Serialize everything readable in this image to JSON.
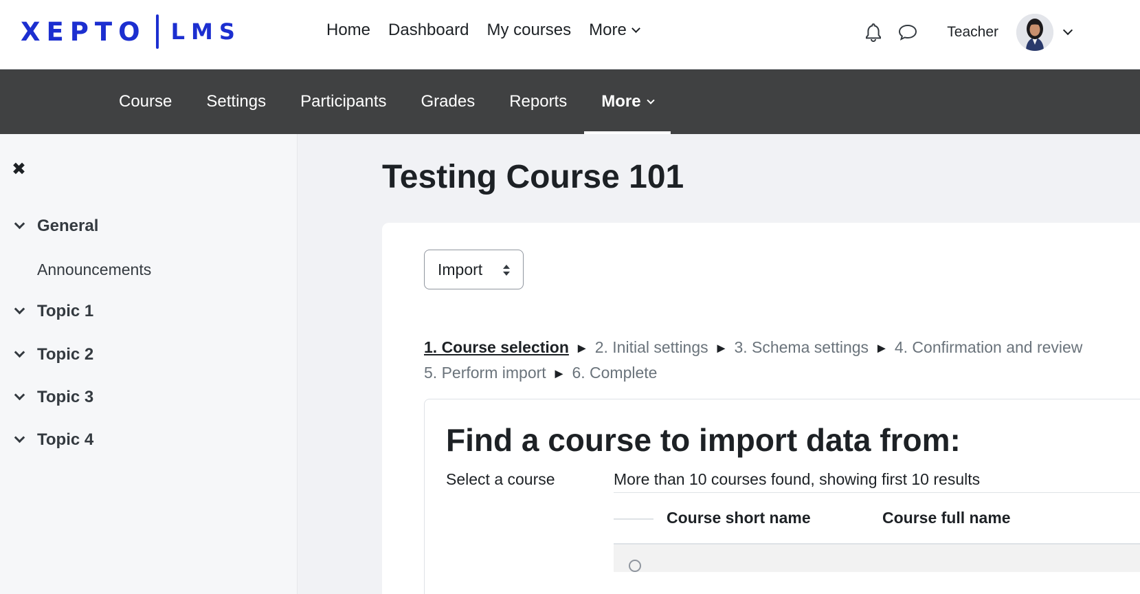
{
  "brand": {
    "logo_word": "XEPTO",
    "logo_sub": "LMS",
    "color": "#1c2fd0"
  },
  "primary_nav": {
    "home": "Home",
    "dashboard": "Dashboard",
    "my_courses": "My courses",
    "more": "More"
  },
  "user": {
    "name": "Teacher"
  },
  "secondary_nav": {
    "course": "Course",
    "settings": "Settings",
    "participants": "Participants",
    "grades": "Grades",
    "reports": "Reports",
    "more": "More"
  },
  "drawer": {
    "close": "✖",
    "sections": [
      "General",
      "Topic 1",
      "Topic 2",
      "Topic 3",
      "Topic 4"
    ],
    "general_items": [
      "Announcements"
    ]
  },
  "page": {
    "title": "Testing Course 101"
  },
  "action_select": {
    "value": "Import"
  },
  "steps": {
    "s1": "1. Course selection",
    "s2": "2. Initial settings",
    "s3": "3. Schema settings",
    "s4": "4. Confirmation and review",
    "s5": "5. Perform import",
    "s6": "6. Complete",
    "separator": "►"
  },
  "import_form": {
    "heading": "Find a course to import data from:",
    "select_label": "Select a course",
    "results_info": "More than 10 courses found, showing first 10 results",
    "columns": [
      "Course short name",
      "Course full name"
    ]
  },
  "colors": {
    "secondary_nav_bg": "#404142",
    "page_bg": "#f1f2f5",
    "drawer_bg": "#f6f7f9"
  }
}
